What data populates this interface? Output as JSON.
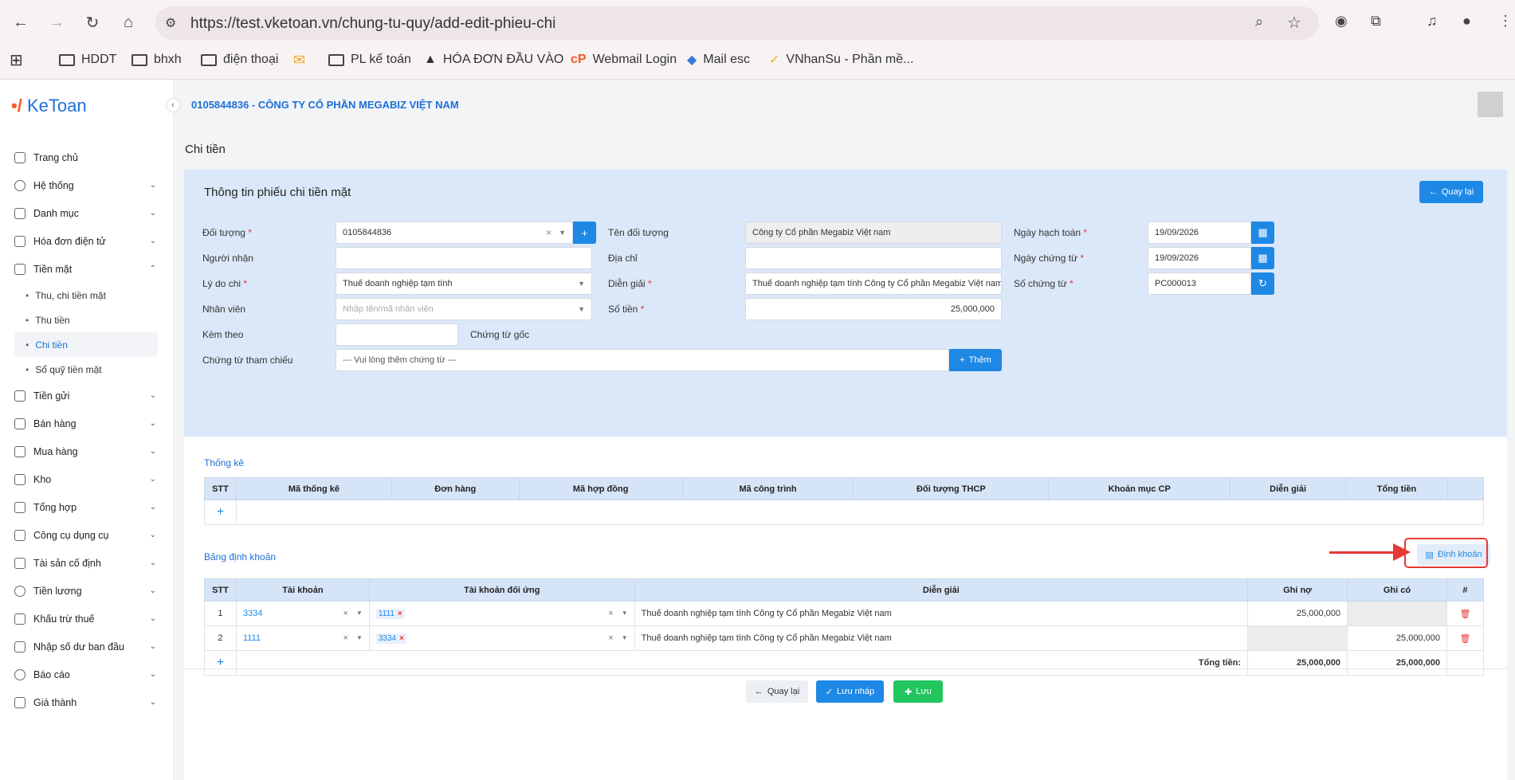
{
  "browser": {
    "url": "https://test.vketoan.vn/chung-tu-quy/add-edit-phieu-chi",
    "bookmarks": [
      "HDDT",
      "bhxh",
      "điện thoại",
      "",
      "PL kế toán",
      "HÓA ĐƠN ĐẦU VÀO",
      "Webmail Login",
      "Mail esc",
      "VNhanSu - Phần mề..."
    ]
  },
  "app": {
    "logo": "KeToan",
    "company": "0105844836 - CÔNG TY CỔ PHẦN MEGABIZ VIỆT NAM",
    "page_title": "Chi tiền"
  },
  "sidebar": {
    "items": [
      {
        "label": "Trang chủ",
        "icon": "home-icon"
      },
      {
        "label": "Hệ thống",
        "icon": "settings-icon"
      },
      {
        "label": "Danh mục",
        "icon": "category-icon"
      },
      {
        "label": "Hóa đơn điện tử",
        "icon": "invoice-icon"
      },
      {
        "label": "Tiền mặt",
        "icon": "cash-icon"
      },
      {
        "label": "Tiền gửi",
        "icon": "bank-icon"
      },
      {
        "label": "Bán hàng",
        "icon": "sales-icon"
      },
      {
        "label": "Mua hàng",
        "icon": "purchase-icon"
      },
      {
        "label": "Kho",
        "icon": "warehouse-icon"
      },
      {
        "label": "Tổng hợp",
        "icon": "chart-icon"
      },
      {
        "label": "Công cụ dụng cụ",
        "icon": "tools-icon"
      },
      {
        "label": "Tài sản cố định",
        "icon": "asset-icon"
      },
      {
        "label": "Tiền lương",
        "icon": "salary-icon"
      },
      {
        "label": "Khấu trừ thuế",
        "icon": "tax-icon"
      },
      {
        "label": "Nhập số dư ban đầu",
        "icon": "balance-icon"
      },
      {
        "label": "Báo cáo",
        "icon": "report-icon"
      },
      {
        "label": "Giá thành",
        "icon": "cost-icon"
      }
    ],
    "cash_sub": [
      "Thu, chi tiền mặt",
      "Thu tiền",
      "Chi tiền",
      "Sổ quỹ tiền mặt"
    ]
  },
  "form": {
    "title": "Thông tin phiếu chi tiền mặt",
    "back_label": "Quay lại",
    "doi_tuong_label": "Đối tượng",
    "doi_tuong_value": "0105844836",
    "ten_doi_tuong_label": "Tên đối tượng",
    "ten_doi_tuong_value": "Công ty Cổ phần Megabiz Việt nam",
    "ngay_hach_toan_label": "Ngày hạch toán",
    "ngay_hach_toan_value": "19/09/2026",
    "nguoi_nhan_label": "Người nhận",
    "dia_chi_label": "Địa chỉ",
    "ngay_chung_tu_label": "Ngày chứng từ",
    "ngay_chung_tu_value": "19/09/2026",
    "ly_do_chi_label": "Lý do chi",
    "ly_do_chi_value": "Thuế doanh nghiệp tạm tính",
    "dien_giai_label": "Diễn giải",
    "dien_giai_value": "Thuế doanh nghiệp tạm tính Công ty Cổ phần Megabiz Việt nam",
    "so_chung_tu_label": "Số chứng từ",
    "so_chung_tu_value": "PC000013",
    "nhan_vien_label": "Nhân viên",
    "nhan_vien_placeholder": "Nhập tên/mã nhân viên",
    "so_tien_label": "Số tiền",
    "so_tien_value": "25,000,000",
    "kem_theo_label": "Kèm theo",
    "chung_tu_goc_label": "Chứng từ gốc",
    "chung_tu_tham_chieu_label": "Chứng từ tham chiếu",
    "chung_tu_tham_chieu_placeholder": "--- Vui lòng thêm chứng từ ---",
    "them_label": "Thêm"
  },
  "thong_ke": {
    "title": "Thống kê",
    "headers": [
      "STT",
      "Mã thống kê",
      "Đơn hàng",
      "Mã hợp đồng",
      "Mã công trình",
      "Đối tượng THCP",
      "Khoản mục CP",
      "Diễn giải",
      "Tổng tiền"
    ]
  },
  "dinh_khoan": {
    "title": "Bảng định khoản",
    "button": "Định khoản",
    "headers": [
      "STT",
      "Tài khoản",
      "Tài khoản đối ứng",
      "Diễn giải",
      "Ghi nợ",
      "Ghi có",
      "#"
    ],
    "rows": [
      {
        "stt": "1",
        "tk": "3334",
        "tk_du": "1111",
        "dien_giai": "Thuế doanh nghiệp tạm tính Công ty Cổ phần Megabiz Việt nam",
        "no": "25,000,000",
        "co": ""
      },
      {
        "stt": "2",
        "tk": "1111",
        "tk_du": "3334",
        "dien_giai": "Thuế doanh nghiệp tạm tính Công ty Cổ phần Megabiz Việt nam",
        "no": "",
        "co": "25,000,000"
      }
    ],
    "total_label": "Tổng tiền:",
    "total_no": "25,000,000",
    "total_co": "25,000,000"
  },
  "footer": {
    "back": "Quay lại",
    "save_draft": "Lưu nháp",
    "save": "Lưu"
  }
}
